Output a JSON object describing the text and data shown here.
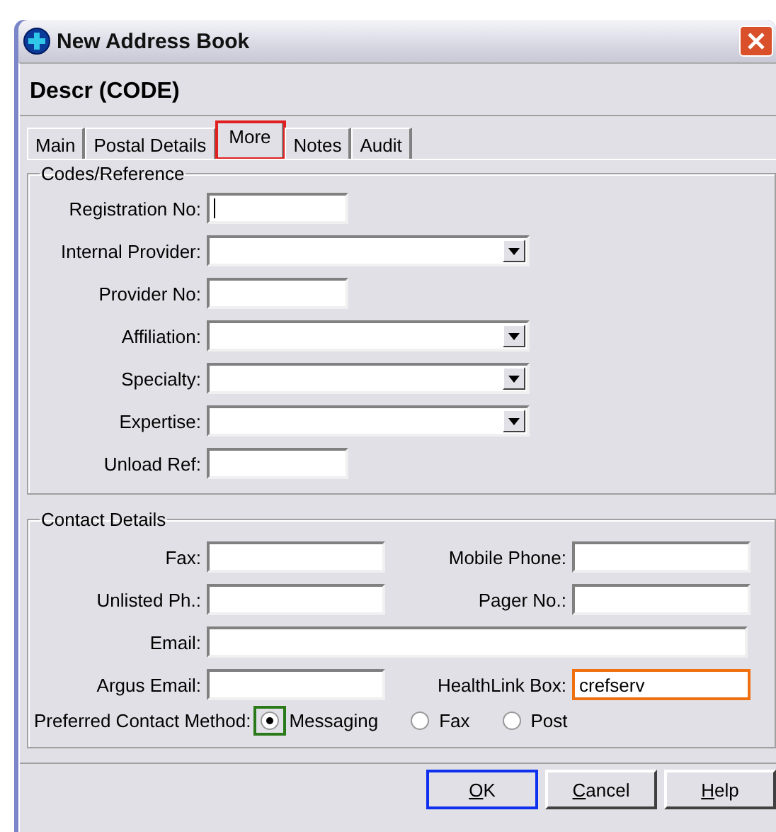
{
  "window": {
    "title": "New Address Book"
  },
  "header": "Descr (CODE)",
  "tabs": [
    {
      "label": "Main",
      "selected": false
    },
    {
      "label": "Postal Details",
      "selected": false
    },
    {
      "label": "More",
      "selected": true,
      "color": "#e02020"
    },
    {
      "label": "Notes",
      "selected": false
    },
    {
      "label": "Audit",
      "selected": false
    }
  ],
  "codes_reference": {
    "title": "Codes/Reference",
    "fields": [
      {
        "label": "Registration No:",
        "kind": "text",
        "focused": true
      },
      {
        "label": "Internal Provider:",
        "kind": "dropdown"
      },
      {
        "label": "Provider No:",
        "kind": "text",
        "focused": false
      },
      {
        "label": "Affiliation:",
        "kind": "dropdown"
      },
      {
        "label": "Specialty:",
        "kind": "dropdown"
      },
      {
        "label": "Expertise:",
        "kind": "dropdown"
      },
      {
        "label": "Unload Ref:",
        "kind": "text",
        "focused": false
      }
    ]
  },
  "contact_details": {
    "title": "Contact Details",
    "rows": [
      [
        {
          "label": "Fax:"
        },
        {
          "label": "Mobile Phone:"
        }
      ],
      [
        {
          "label": "Unlisted Ph.:"
        },
        {
          "label": "Pager No.:"
        }
      ],
      [
        {
          "label": "Email:",
          "wide": true
        }
      ],
      [
        {
          "label": "Argus Email:"
        },
        {
          "label": "HealthLink Box:",
          "value": "crefserv",
          "color": "#f07010"
        }
      ]
    ],
    "preferred_contact": {
      "label": "Preferred Contact Method:",
      "options": [
        {
          "label": "Messaging",
          "selected": true,
          "color": "#2a7a1a"
        },
        {
          "label": "Fax",
          "selected": false
        },
        {
          "label": "Post",
          "selected": false
        }
      ]
    }
  },
  "buttons": [
    {
      "label": "OK",
      "color": "#1030f0"
    },
    {
      "label": "Cancel"
    },
    {
      "label": "Help"
    }
  ]
}
